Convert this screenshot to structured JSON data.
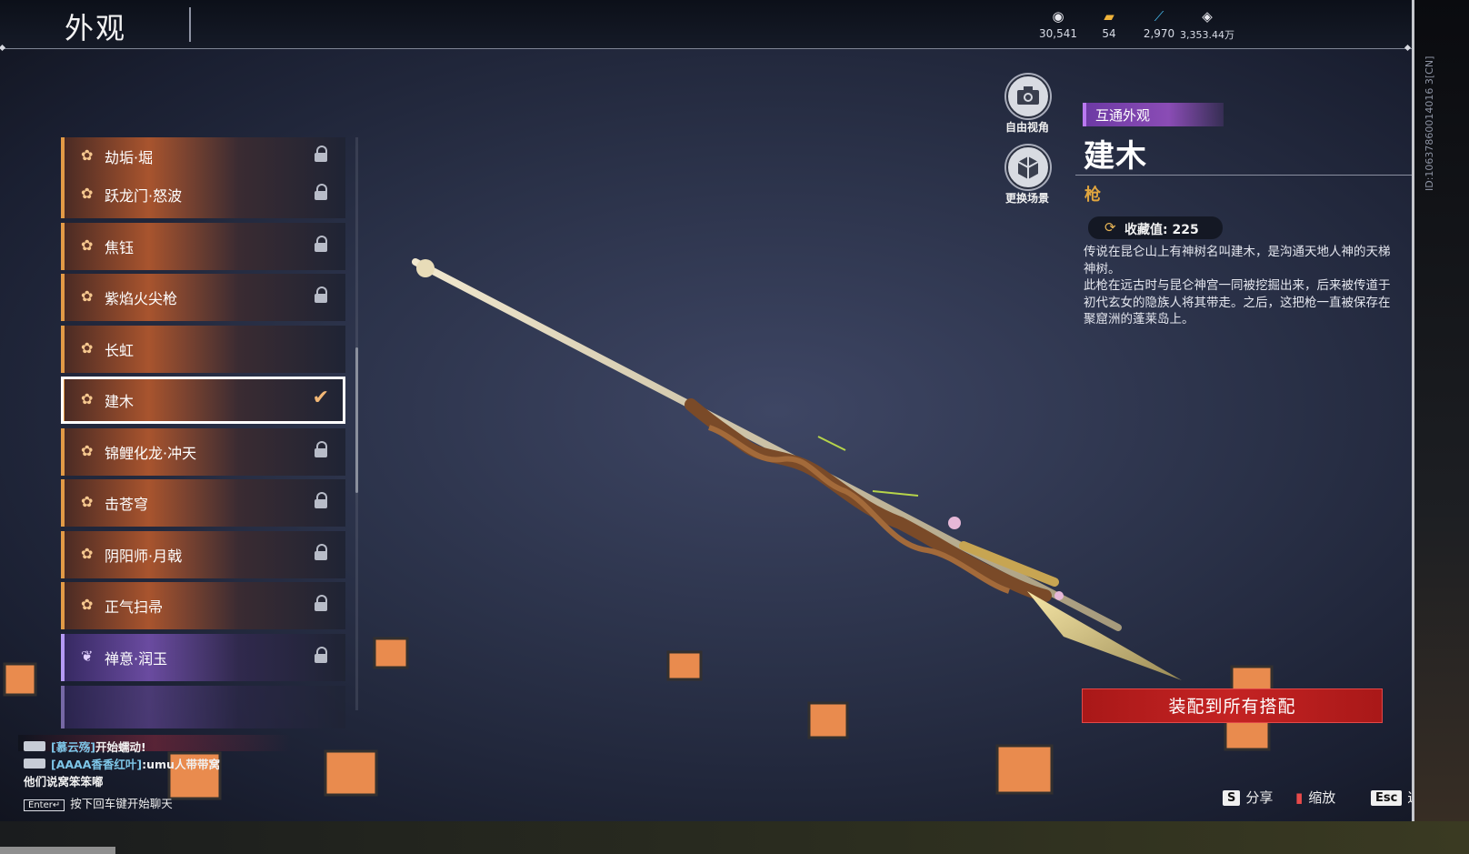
{
  "header": {
    "title": "外观",
    "currencies": [
      {
        "icon": "eye-coin-icon",
        "value": "30,541"
      },
      {
        "icon": "gold-ticket-icon",
        "value": "54"
      },
      {
        "icon": "feather-icon",
        "value": "2,970"
      },
      {
        "icon": "diamond-coin-icon",
        "value": "3,353.44万"
      }
    ]
  },
  "list": {
    "items": [
      {
        "label": "劫垢·堀",
        "state": "locked",
        "rarity": "orange"
      },
      {
        "label": "跃龙门·怒波",
        "state": "locked",
        "rarity": "orange"
      },
      {
        "label": "焦钰",
        "state": "locked",
        "rarity": "orange"
      },
      {
        "label": "紫焰火尖枪",
        "state": "locked",
        "rarity": "orange"
      },
      {
        "label": "长虹",
        "state": "unlocked",
        "rarity": "orange"
      },
      {
        "label": "建木",
        "state": "equipped",
        "rarity": "orange"
      },
      {
        "label": "锦鲤化龙·冲天",
        "state": "locked",
        "rarity": "orange"
      },
      {
        "label": "击苍穹",
        "state": "locked",
        "rarity": "orange"
      },
      {
        "label": "阴阳师·月戟",
        "state": "locked",
        "rarity": "orange"
      },
      {
        "label": "正气扫帚",
        "state": "locked",
        "rarity": "orange"
      },
      {
        "label": "禅意·润玉",
        "state": "locked",
        "rarity": "purple"
      }
    ]
  },
  "tools": {
    "free_view": "自由视角",
    "change_scene": "更换场景"
  },
  "detail": {
    "tag": "互通外观",
    "name": "建木",
    "type": "枪",
    "collect_label": "收藏值: 225",
    "desc1": "传说在昆仑山上有神树名叫建木，是沟通天地人神的天梯神树。",
    "desc2": "此枪在远古时与昆仑神宫一同被挖掘出来，后来被传道于初代玄女的隐族人将其带走。之后，这把枪一直被保存在聚窟洲的蓬莱岛上。",
    "side_id": "ID:10637860014016 3[CN]"
  },
  "actions": {
    "equip_all": "装配到所有搭配"
  },
  "hints": [
    {
      "key": "S",
      "label": "分享"
    },
    {
      "key": "",
      "label": "缩放"
    },
    {
      "key": "Esc",
      "label": "返回"
    }
  ],
  "chat": {
    "line1_who": "[慕云殇]",
    "line1_msg": "开始蠕动!",
    "line2_who": "[AAAA香香红叶]",
    "line2_msg": ":umu人带带窝",
    "line3": "他们说窝笨笨嘟",
    "enter_key": "Enter↵",
    "enter_hint": "按下回车键开始聊天"
  },
  "colors": {
    "accent_orange": "#e29a46",
    "accent_purple": "#b59af5",
    "equip_red": "#c42323",
    "type_gold": "#e0a53f"
  }
}
